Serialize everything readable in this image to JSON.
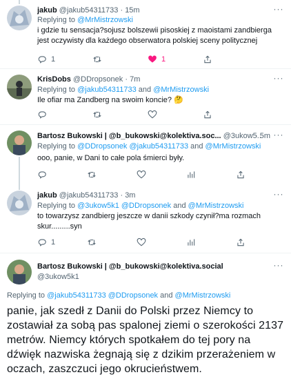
{
  "tweets": [
    {
      "name": "jakub",
      "handle": "@jakub54311733",
      "sep": "·",
      "time": "15m",
      "reply_prefix": "Replying to",
      "reply_to": "@MrMistrzowski",
      "text": "i gdzie tu sensacja?sojusz bolszewii pisoskiej z maoistami zandbierga jest oczywisty dla każdego obserwatora polskiej sceny politycznej",
      "replies": "1",
      "retweets": "",
      "likes": "1",
      "liked": true
    },
    {
      "name": "KrisDobs",
      "handle": "@DDropsonek",
      "sep": "·",
      "time": "7m",
      "reply_prefix": "Replying to",
      "reply_to": "@jakub54311733",
      "and": "and",
      "reply_to_2": "@MrMistrzowski",
      "text": "Ile ofiar ma Zandberg na swoim koncie? 🤔"
    },
    {
      "name": "Bartosz Bukowski | @b_bukowski@kolektiva.soc...",
      "handle": "@3ukow5...",
      "sep": "·",
      "time": "5m",
      "reply_prefix": "Replying to",
      "reply_to": "@DDropsonek @jakub54311733",
      "and": "and",
      "reply_to_2": "@MrMistrzowski",
      "text": "ooo, panie, w Dani to całe pola śmierci były."
    },
    {
      "name": "jakub",
      "handle": "@jakub54311733",
      "sep": "·",
      "time": "3m",
      "reply_prefix": "Replying to",
      "reply_to": "@3ukow5k1 @DDropsonek",
      "and": "and",
      "reply_to_2": "@MrMistrzowski",
      "text": "to towarzysz zandbierg  jeszcze w danii szkody czynił?ma rozmach skur.........syn",
      "replies": "1"
    }
  ],
  "main_tweet": {
    "name": "Bartosz Bukowski | @b_bukowski@kolektiva.social",
    "handle": "@3ukow5k1",
    "reply_prefix": "Replying to",
    "reply_to": "@jakub54311733 @DDropsonek",
    "and": "and",
    "reply_to_2": "@MrMistrzowski",
    "text": "panie, jak szedł z Danii do Polski przez Niemcy to zostawiał za sobą pas spalonej ziemi o szerokości 2137 metrów. Niemcy których spotkałem do tej pory na dźwięk nazwiska żegnają się z dzikim przerażeniem w oczach, zaszczuci jego okrucieństwem."
  },
  "icons": [
    "more-icon",
    "reply-icon",
    "retweet-icon",
    "like-icon",
    "share-icon",
    "analytics-icon"
  ],
  "colors": {
    "link": "#1d9bf0",
    "muted": "#536471",
    "like_active": "#f91880",
    "thread_line": "#cfd9de"
  }
}
